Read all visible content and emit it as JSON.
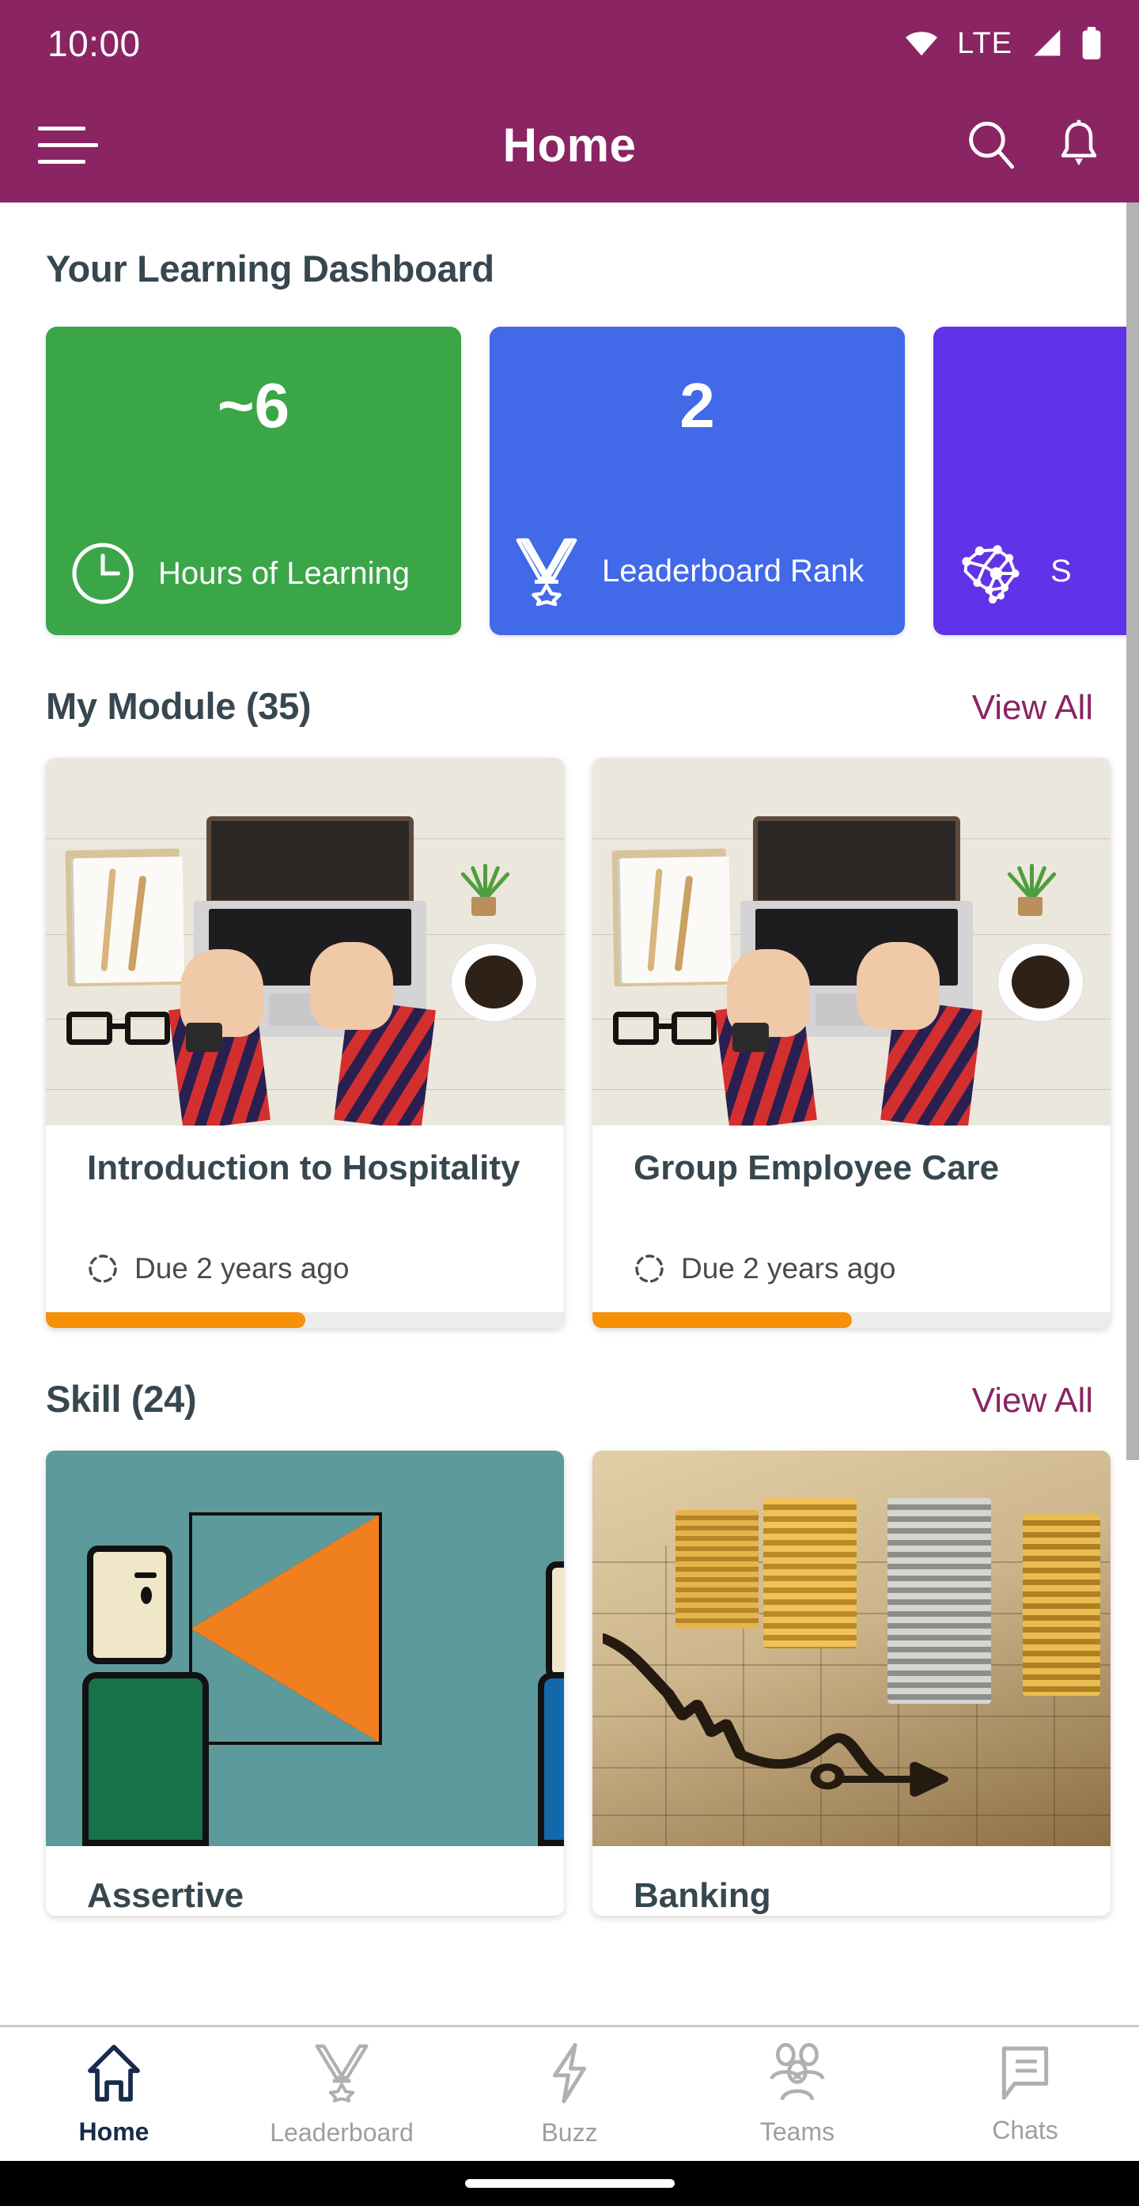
{
  "status_bar": {
    "time": "10:00",
    "network_type": "LTE",
    "icons": [
      "wifi-icon",
      "signal-icon",
      "battery-icon"
    ]
  },
  "app_bar": {
    "title": "Home",
    "menu_icon": "hamburger-menu-icon",
    "search_icon": "search-icon",
    "notification_icon": "bell-icon",
    "background_color": "#8a2463"
  },
  "dashboard": {
    "title": "Your Learning Dashboard",
    "stats": [
      {
        "value": "~6",
        "label": "Hours of Learning",
        "icon": "clock-icon",
        "color": "#3aa648"
      },
      {
        "value": "2",
        "label": "Leaderboard Rank",
        "icon": "medal-icon",
        "color": "#4169e8"
      },
      {
        "value": "",
        "label": "S",
        "icon": "brain-network-icon",
        "color": "#6133e8"
      }
    ]
  },
  "sections": [
    {
      "title": "My Module (35)",
      "view_all": "View All",
      "items": [
        {
          "title": "Introduction to Hospitality",
          "due": "Due 2 years ago",
          "due_icon": "progress-circle-icon",
          "progress_percent": 50,
          "thumb": "desk-laptop-photo"
        },
        {
          "title": "Group Employee Care",
          "due": "Due 2 years ago",
          "due_icon": "progress-circle-icon",
          "progress_percent": 50,
          "thumb": "desk-laptop-photo"
        }
      ]
    },
    {
      "title": "Skill (24)",
      "view_all": "View All",
      "items": [
        {
          "title": "Assertive",
          "thumb": "megaphone-illustration"
        },
        {
          "title": "Banking",
          "thumb": "coins-chart-photo"
        }
      ]
    }
  ],
  "bottom_nav": {
    "items": [
      {
        "label": "Home",
        "icon": "home-icon",
        "active": true
      },
      {
        "label": "Leaderboard",
        "icon": "medal-icon",
        "active": false
      },
      {
        "label": "Buzz",
        "icon": "lightning-bolt-icon",
        "active": false
      },
      {
        "label": "Teams",
        "icon": "people-icon",
        "active": false
      },
      {
        "label": "Chats",
        "icon": "chat-bubble-icon",
        "active": false
      }
    ]
  },
  "colors": {
    "brand": "#8a2463",
    "progress": "#f79009",
    "heading": "#37474f",
    "nav_active": "#192b4b",
    "nav_inactive": "#9e9e9e"
  }
}
